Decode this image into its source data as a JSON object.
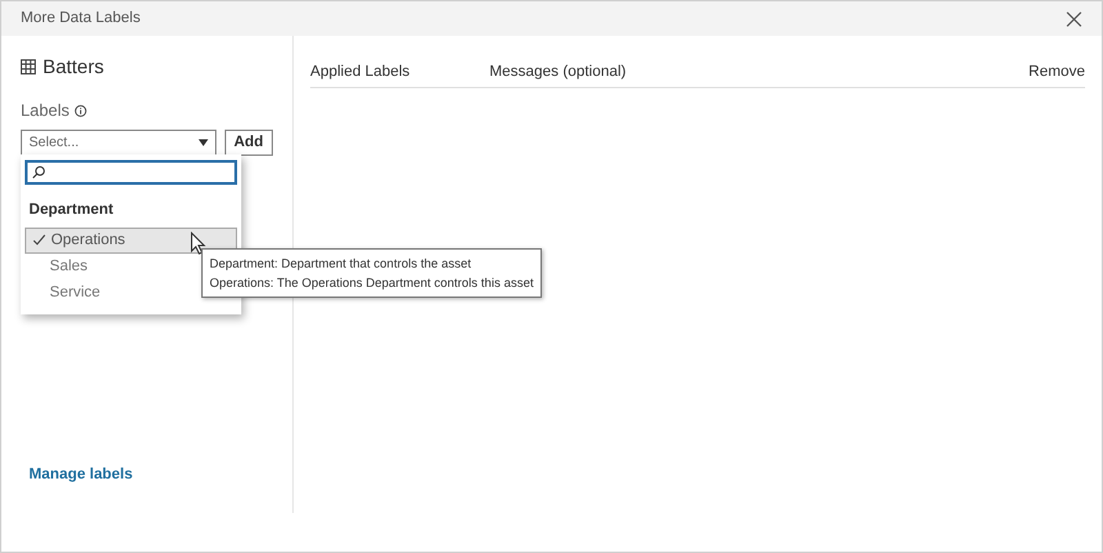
{
  "window": {
    "title": "More Data Labels"
  },
  "asset": {
    "name": "Batters"
  },
  "labels_field": {
    "label": "Labels",
    "placeholder": "Select...",
    "add_button": "Add"
  },
  "dropdown": {
    "group": "Department",
    "options": [
      {
        "label": "Operations",
        "selected": true
      },
      {
        "label": "Sales",
        "selected": false
      },
      {
        "label": "Service",
        "selected": false
      }
    ]
  },
  "tooltip": {
    "lines": [
      "Department: Department that controls the asset",
      "Operations: The Operations Department controls this asset"
    ]
  },
  "table": {
    "columns": [
      "Applied Labels",
      "Messages (optional)",
      "Remove"
    ]
  },
  "manage_link": "Manage labels"
}
